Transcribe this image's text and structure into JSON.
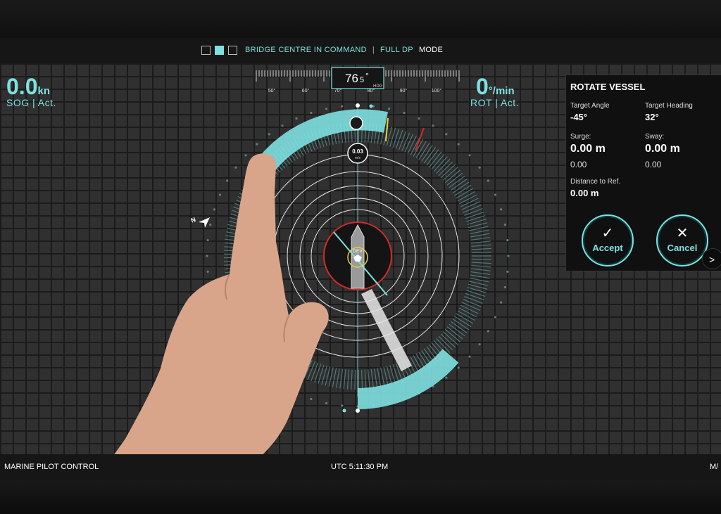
{
  "topbar": {
    "command": "BRIDGE CENTRE IN COMMAND",
    "separator": "|",
    "mode_value": "FULL DP",
    "mode_label": "MODE"
  },
  "speed": {
    "value": "0.0",
    "unit": "kn",
    "label": "SOG | Act."
  },
  "rot": {
    "value": "0",
    "unit": "°/min",
    "label": "ROT | Act."
  },
  "heading": {
    "display": "76",
    "decimal": "5",
    "degree": "°",
    "hdg_label": "HDG",
    "ticks": [
      "50°",
      "60°",
      "70°",
      "80°",
      "90°",
      "100°"
    ]
  },
  "compass": {
    "speed_value": "0.03",
    "speed_unit": "m/s",
    "center_label": "DEV",
    "north_label": "N",
    "accent": "#7fe0e0"
  },
  "panel": {
    "title": "ROTATE VESSEL",
    "target_angle_label": "Target Angle",
    "target_angle_value": "-45°",
    "target_heading_label": "Target Heading",
    "target_heading_value": "32°",
    "surge_label": "Surge:",
    "surge_value": "0.00 m",
    "surge_sub": "0.00",
    "sway_label": "Sway:",
    "sway_value": "0.00 m",
    "sway_sub": "0.00",
    "distance_label": "Distance to Ref.",
    "distance_value": "0.00 m",
    "accept_label": "Accept",
    "cancel_label": "Cancel",
    "next_glyph": ">"
  },
  "bottombar": {
    "left": "MARINE PILOT CONTROL",
    "time": "UTC 5:11:30 PM",
    "right": "M/"
  }
}
